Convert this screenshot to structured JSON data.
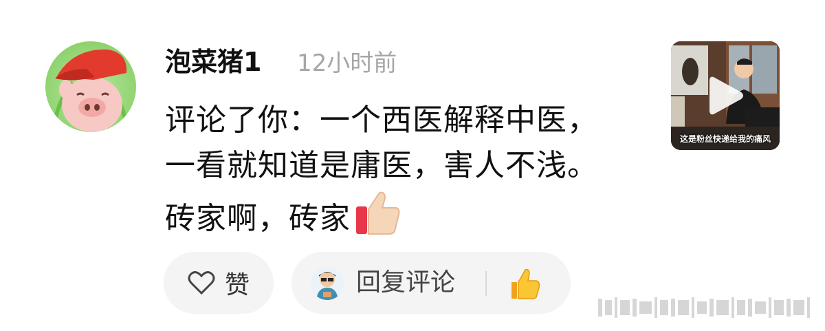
{
  "comment": {
    "username": "泡菜猪1",
    "time_ago": "12小时前",
    "text": "评论了你：一个西医解释中医，一看就知道是庸医，害人不浅。砖家啊，砖家"
  },
  "thumbnail": {
    "caption": "这是粉丝快递给我的痛风",
    "icon": "play-icon"
  },
  "actions": {
    "like_label": "赞",
    "like_icon": "heart-outline-icon",
    "reply_label": "回复评论",
    "reply_quick_icon": "thumbs-up-icon"
  },
  "colors": {
    "timestamp": "#a6a6a6",
    "pill_background": "#f4f4f4"
  }
}
